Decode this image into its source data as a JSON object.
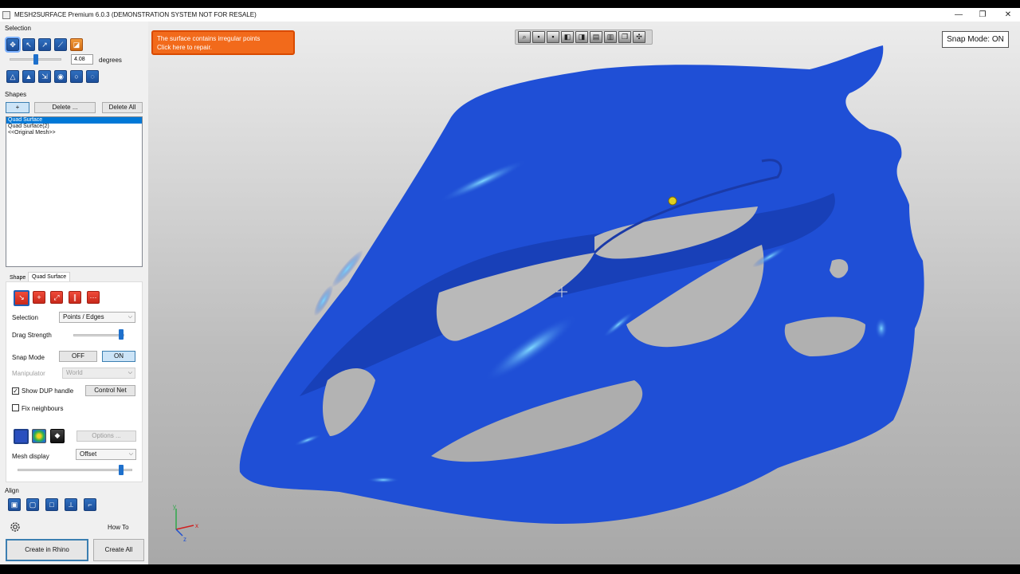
{
  "window": {
    "title": "MESH2SURFACE Premium 6.0.3 (DEMONSTRATION SYSTEM NOT FOR RESALE)",
    "minimize": "—",
    "restore": "❐",
    "close": "✕"
  },
  "selection": {
    "heading": "Selection",
    "angle_value": "4.08",
    "angle_unit": "degrees",
    "angle_slider_level": 0.5
  },
  "shapes": {
    "heading": "Shapes",
    "add_label": "+",
    "delete_label": "Delete ...",
    "delete_all_label": "Delete All",
    "items": [
      {
        "label": "Quad Surface",
        "selected": true
      },
      {
        "label": "Quad Surface(2)",
        "selected": false
      },
      {
        "label": "<<Original Mesh>>",
        "selected": false
      }
    ]
  },
  "tabs": {
    "shape": "Shape",
    "quad_surface": "Quad Surface"
  },
  "quad": {
    "selection_label": "Selection",
    "selection_value": "Points / Edges",
    "drag_strength_label": "Drag Strength",
    "drag_strength_level": 0.94,
    "snap_mode_label": "Snap Mode",
    "snap_off": "OFF",
    "snap_on": "ON",
    "manipulator_label": "Manipulator",
    "manipulator_value": "World",
    "show_dup_label": "Show DUP handle",
    "show_dup_checked": true,
    "control_net_label": "Control Net",
    "fix_neighbours_label": "Fix neighbours",
    "fix_neighbours_checked": false,
    "options_label": "Options ...",
    "mesh_display_label": "Mesh display",
    "mesh_display_value": "Offset",
    "mesh_display_level": 0.9
  },
  "align": {
    "heading": "Align"
  },
  "bottom": {
    "how_to": "How To",
    "create_in_rhino": "Create in Rhino",
    "create_all": "Create All"
  },
  "viewport": {
    "alert_line1": "The surface contains irregular points",
    "alert_line2": "Click here to repair.",
    "snap_mode_status": "Snap Mode: ON",
    "axis_x": "x",
    "axis_y": "y",
    "axis_z": "z",
    "model_color": "#1f4fd6"
  }
}
